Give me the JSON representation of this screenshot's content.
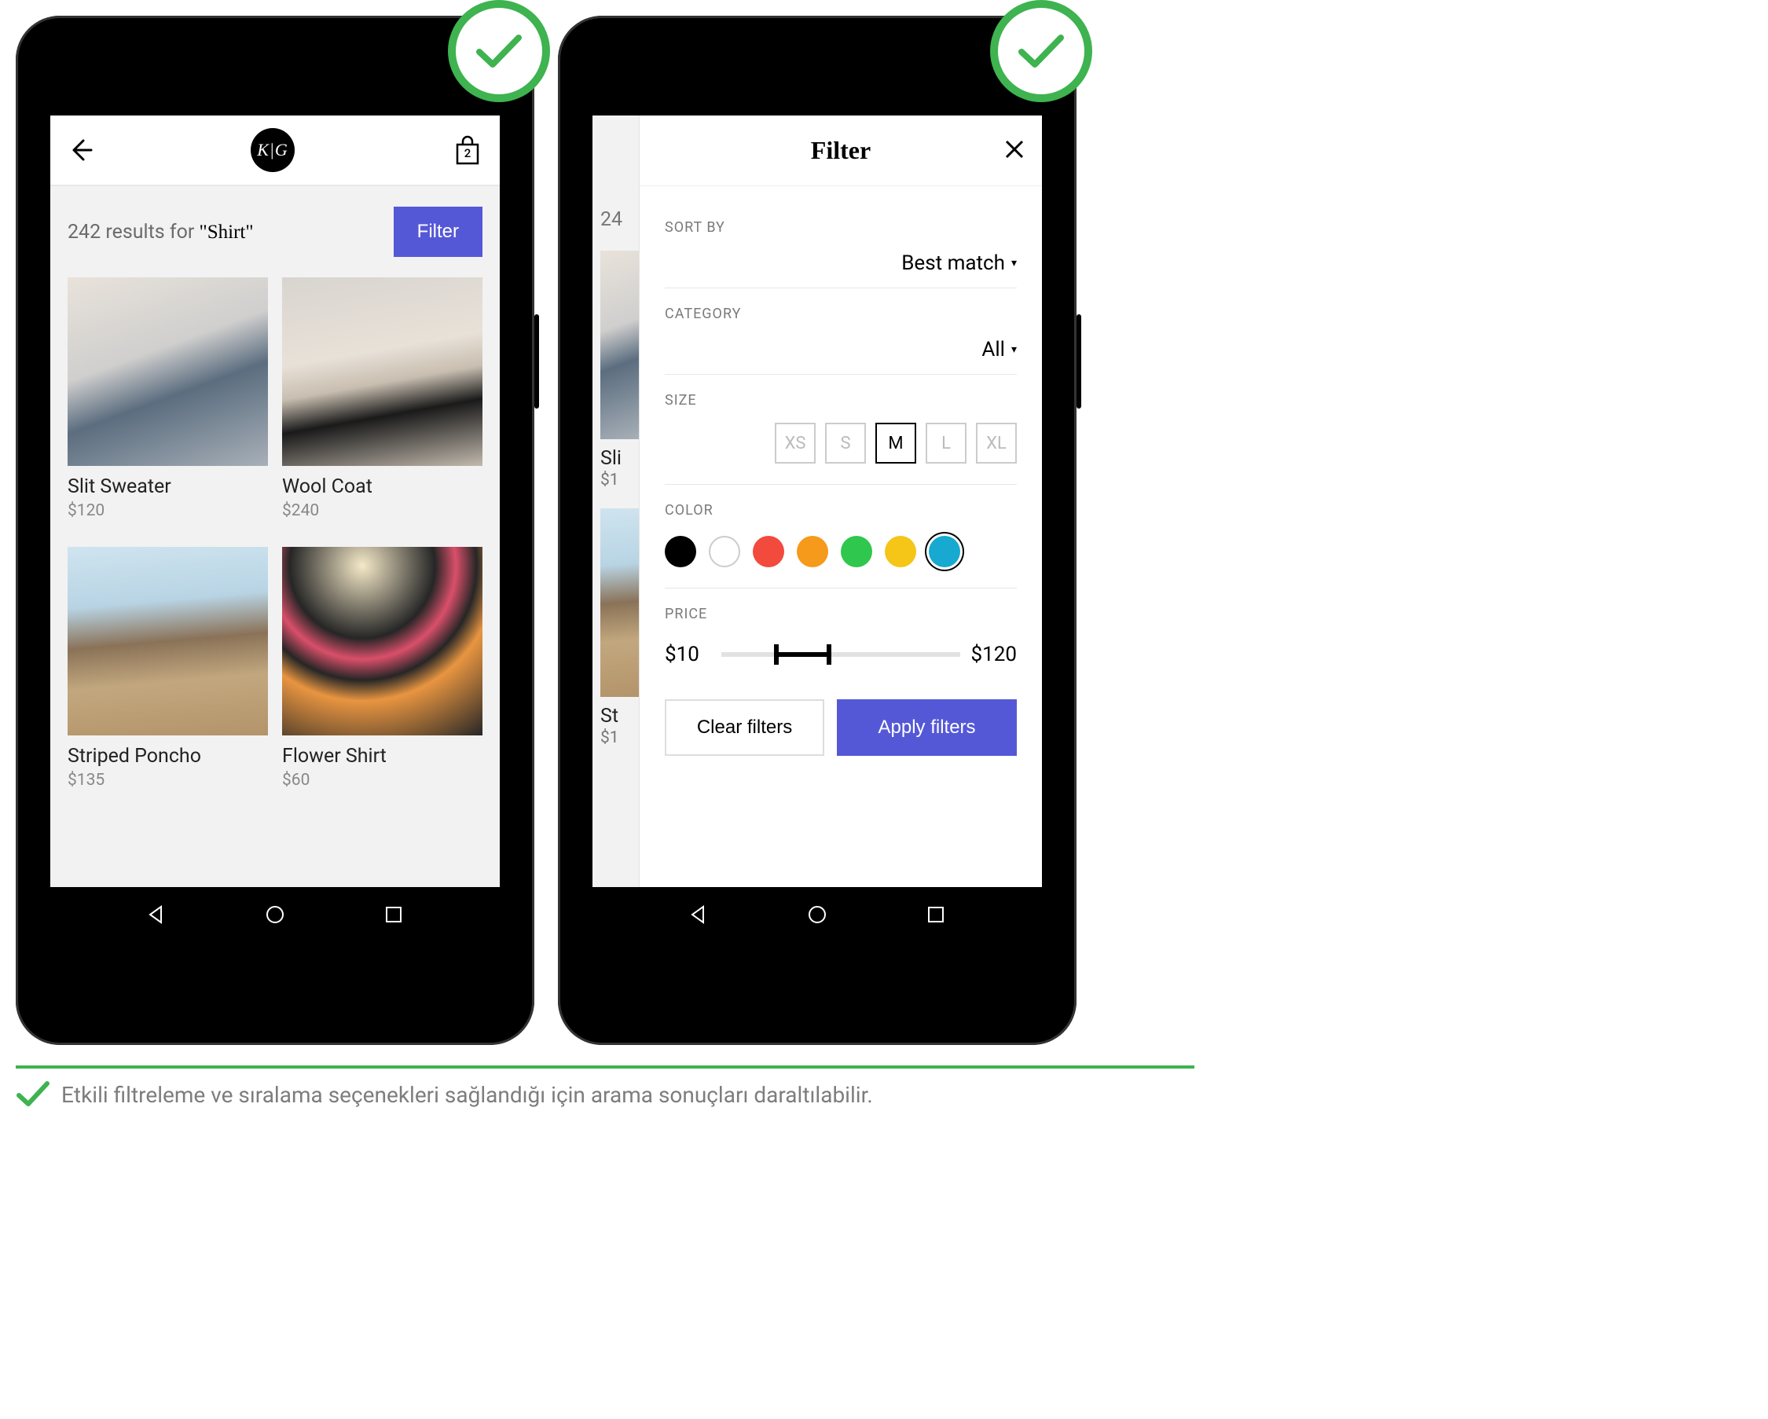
{
  "leftPhone": {
    "logo": "K|G",
    "bagCount": "2",
    "resultsCount": "242",
    "resultsFor": "results for",
    "query": "\"Shirt\"",
    "filterBtn": "Filter",
    "products": [
      {
        "name": "Slit Sweater",
        "price": "$120"
      },
      {
        "name": "Wool Coat",
        "price": "$240"
      },
      {
        "name": "Striped Poncho",
        "price": "$135"
      },
      {
        "name": "Flower Shirt",
        "price": "$60"
      }
    ]
  },
  "rightPhone": {
    "peekCount": "24",
    "peekNameA": "Sli",
    "peekPriceA": "$1",
    "peekNameB": "St",
    "peekPriceB": "$1",
    "title": "Filter",
    "sortLabel": "SORT BY",
    "sortValue": "Best match",
    "categoryLabel": "CATEGORY",
    "categoryValue": "All",
    "sizeLabel": "SIZE",
    "sizes": [
      "XS",
      "S",
      "M",
      "L",
      "XL"
    ],
    "selectedSize": "M",
    "colorLabel": "COLOR",
    "colors": [
      {
        "hex": "#000000",
        "selected": false,
        "outlined": false
      },
      {
        "hex": "#ffffff",
        "selected": false,
        "outlined": true
      },
      {
        "hex": "#f24a3d",
        "selected": false,
        "outlined": false
      },
      {
        "hex": "#f59a1b",
        "selected": false,
        "outlined": false
      },
      {
        "hex": "#2fc74d",
        "selected": false,
        "outlined": false
      },
      {
        "hex": "#f5c518",
        "selected": false,
        "outlined": false
      },
      {
        "hex": "#17a9cf",
        "selected": true,
        "outlined": false
      }
    ],
    "priceLabel": "PRICE",
    "priceMin": "$10",
    "priceMax": "$120",
    "clearBtn": "Clear filters",
    "applyBtn": "Apply filters"
  },
  "caption": "Etkili filtreleme ve sıralama seçenekleri sağlandığı için arama sonuçları daraltılabilir."
}
